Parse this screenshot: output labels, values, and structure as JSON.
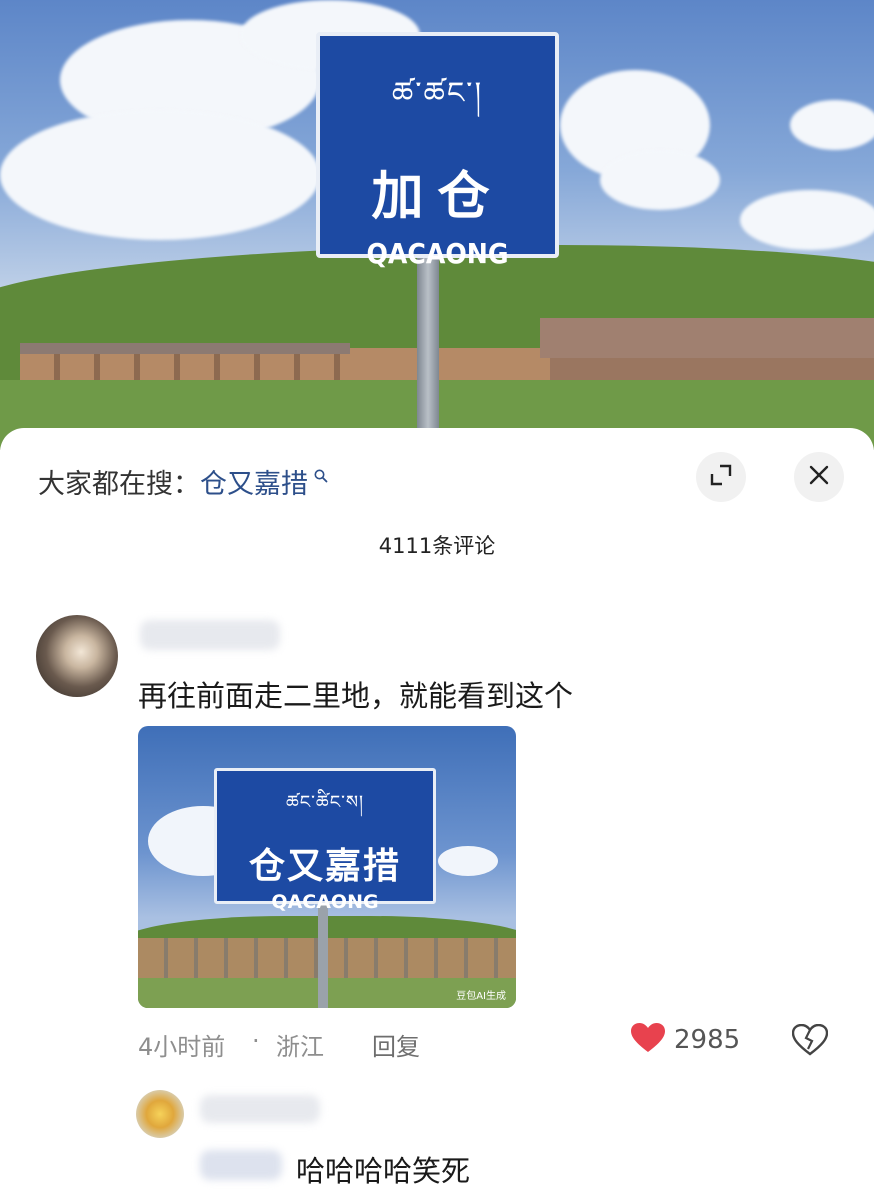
{
  "photo": {
    "sign_tibetan": "ཚ་ཚང་།",
    "sign_chinese": "加仓",
    "sign_pinyin": "QACAONG"
  },
  "sheet": {
    "hot_search_label": "大家都在搜：",
    "hot_search_keyword": "仓又嘉措",
    "hot_search_icon": "search-icon",
    "expand_icon": "expand-icon",
    "close_icon": "close-icon",
    "comment_count": "4111条评论"
  },
  "comment": {
    "text": "再往前面走二里地，就能看到这个",
    "image": {
      "sign_tibetan": "ཚང་ཚིང་ས།",
      "sign_chinese": "仓又嘉措",
      "sign_pinyin": "QACAONG",
      "ai_mark": "豆包AI生成"
    },
    "time": "4小时前",
    "separator": "·",
    "location": "浙江",
    "reply_label": "回复",
    "likes": "2985",
    "like_color": "#e8424e",
    "dislike_icon": "broken-heart-icon"
  },
  "reply": {
    "text": "哈哈哈哈笑死"
  }
}
